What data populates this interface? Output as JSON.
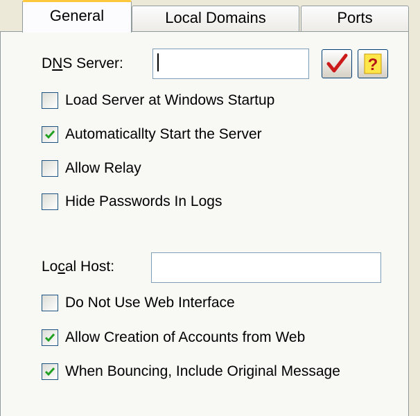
{
  "tabs": [
    {
      "label": "General",
      "active": true
    },
    {
      "label": "Local Domains",
      "active": false
    },
    {
      "label": "Ports",
      "active": false
    }
  ],
  "dns": {
    "label_before": "D",
    "label_accel": "N",
    "label_after": "S Server:",
    "value": ""
  },
  "buttons": {
    "check_icon": "checkmark-icon",
    "help_icon": "question-mark-icon",
    "help_glyph": "?"
  },
  "checkboxes_top": [
    {
      "label": "Load Server at Windows Startup",
      "checked": false
    },
    {
      "label": "Automaticallty Start the Server",
      "checked": true
    },
    {
      "label": "Allow Relay",
      "checked": false
    },
    {
      "label": "Hide Passwords In Logs",
      "checked": false
    }
  ],
  "local_host": {
    "label_before": "Lo",
    "label_accel": "c",
    "label_after": "al Host:",
    "value": ""
  },
  "checkboxes_bottom": [
    {
      "label": "Do Not Use Web Interface",
      "checked": false
    },
    {
      "label": "Allow Creation of Accounts from Web",
      "checked": true
    },
    {
      "label": "When Bouncing, Include Original Message",
      "checked": true
    }
  ],
  "colors": {
    "window_bg": "#ece9d8",
    "panel_bg": "#f8f8f5",
    "check_green": "#21a121",
    "check_red": "#cc1a1a",
    "tab_highlight": "#ffc83c"
  }
}
